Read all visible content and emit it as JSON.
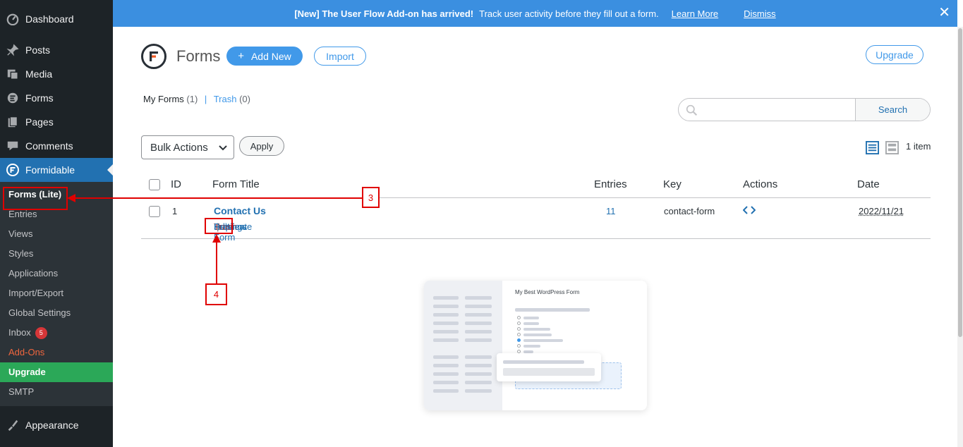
{
  "sidebar": {
    "top_items": [
      {
        "label": "Dashboard",
        "icon": "dashboard-icon"
      },
      {
        "label": "Posts",
        "icon": "pin-icon"
      },
      {
        "label": "Media",
        "icon": "media-icon"
      },
      {
        "label": "Forms",
        "icon": "forms-icon"
      },
      {
        "label": "Pages",
        "icon": "pages-icon"
      },
      {
        "label": "Comments",
        "icon": "comment-icon"
      },
      {
        "label": "Formidable",
        "icon": "formidable-icon"
      }
    ],
    "submenu": [
      {
        "label": "Forms (Lite)"
      },
      {
        "label": "Entries"
      },
      {
        "label": "Views"
      },
      {
        "label": "Styles"
      },
      {
        "label": "Applications"
      },
      {
        "label": "Import/Export"
      },
      {
        "label": "Global Settings"
      },
      {
        "label": "Inbox",
        "badge": "5"
      },
      {
        "label": "Add-Ons"
      },
      {
        "label": "Upgrade"
      },
      {
        "label": "SMTP"
      }
    ],
    "appearance": "Appearance"
  },
  "banner": {
    "bold": "[New] The User Flow Add-on has arrived!",
    "text": "Track user activity before they fill out a form.",
    "learn_more": "Learn More",
    "dismiss": "Dismiss",
    "close": "✕"
  },
  "header": {
    "title": "Forms",
    "add_new": "Add New",
    "import": "Import",
    "upgrade": "Upgrade"
  },
  "views": {
    "my_forms": "My Forms",
    "my_forms_count": "(1)",
    "sep": "|",
    "trash": "Trash",
    "trash_count": "(0)"
  },
  "search": {
    "placeholder": "",
    "button": "Search"
  },
  "bulk": {
    "label": "Bulk Actions",
    "apply": "Apply"
  },
  "items_count": "1 item",
  "table": {
    "headers": {
      "id": "ID",
      "title": "Form Title",
      "entries": "Entries",
      "key": "Key",
      "actions": "Actions",
      "date": "Date"
    },
    "rows": [
      {
        "id": "1",
        "title": "Contact Us",
        "entries": "11",
        "key": "contact-form",
        "date": "2022/11/21",
        "row_actions": {
          "edit": "Edit",
          "settings": "Settings",
          "duplicate": "Duplicate Form",
          "trash": "Trash",
          "preview": "Preview"
        }
      }
    ]
  },
  "annotations": {
    "step3": "3",
    "step4": "4"
  },
  "illustration": {
    "title": "My Best WordPress Form"
  },
  "colors": {
    "accent": "#4199e9",
    "sidebar": "#1d2327",
    "annotation": "#e00000",
    "upgrade": "#2ba858"
  }
}
